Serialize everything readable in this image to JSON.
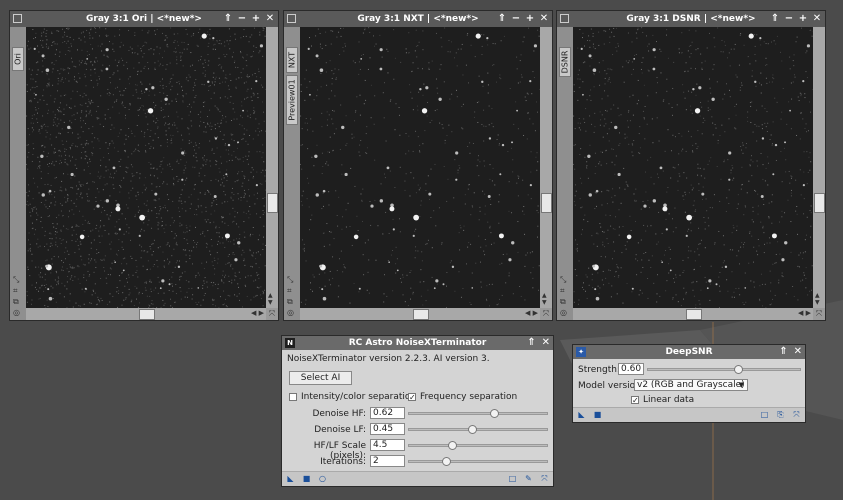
{
  "windows": [
    {
      "title": "Gray 3:1 Ori | <*new*>",
      "tabs": [
        "Ori"
      ]
    },
    {
      "title": "Gray 3:1 NXT | <*new*>",
      "tabs": [
        "NXT",
        "Preview01"
      ]
    },
    {
      "title": "Gray 3:1 DSNR | <*new*>",
      "tabs": [
        "DSNR"
      ]
    }
  ],
  "window_controls": {
    "shade": "⇑",
    "minimize": "−",
    "maximize": "+",
    "close": "✕"
  },
  "noisexterminator": {
    "title": "RC Astro NoiseXTerminator",
    "icon_letter": "N",
    "version_text": "NoiseXTerminator version 2.2.3. AI version 3.",
    "select_ai_label": "Select AI",
    "intensity_color_label": "Intensity/color separation",
    "intensity_color_checked": false,
    "frequency_label": "Frequency separation",
    "frequency_checked": true,
    "params": [
      {
        "label": "Denoise HF:",
        "value": "0.62",
        "level": 0.62
      },
      {
        "label": "Denoise LF:",
        "value": "0.45",
        "level": 0.45
      },
      {
        "label": "HF/LF Scale (pixels):",
        "value": "4.5",
        "level": 0.3
      },
      {
        "label": "Iterations:",
        "value": "2",
        "level": 0.25
      }
    ]
  },
  "deepsnr": {
    "title": "DeepSNR",
    "strength_label": "Strength:",
    "strength_value": "0.60",
    "strength_level": 0.6,
    "model_label": "Model version:",
    "model_value": "v2 (RGB and Grayscale)",
    "linear_label": "Linear data",
    "linear_checked": true
  },
  "colors": {
    "desktop": "#4b4b4b",
    "title_bar": "#5a5a5a",
    "panel_bg": "#d4d4d4",
    "accent": "#1a4f9a"
  }
}
